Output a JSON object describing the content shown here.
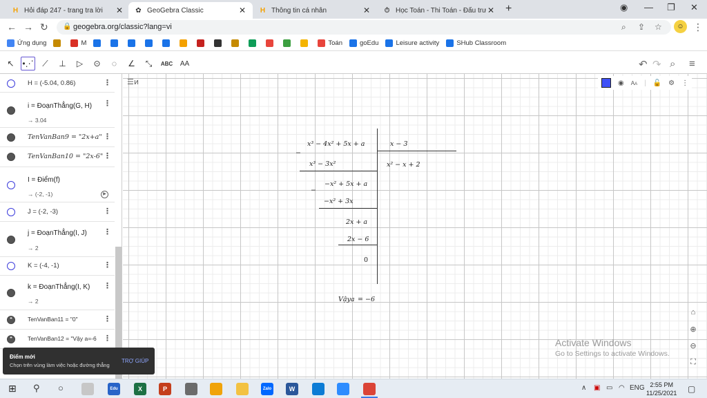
{
  "browser": {
    "tabs": [
      {
        "title": "Hỏi đáp 247 - trang tra lời",
        "favicon": "H"
      },
      {
        "title": "GeoGebra Classic",
        "favicon": "✿"
      },
      {
        "title": "Thông tin cá nhân",
        "favicon": "H"
      },
      {
        "title": "Học Toán - Thi Toán - Đấu trường",
        "favicon": "⏱"
      }
    ],
    "new_tab": "+",
    "url": "geogebra.org/classic?lang=vi",
    "bookmarks": [
      {
        "label": "Ứng dụng",
        "color": "#4285f4"
      },
      {
        "label": "",
        "color": "#c58a00"
      },
      {
        "label": "M",
        "color": "#d93025"
      },
      {
        "label": "",
        "color": "#1a73e8"
      },
      {
        "label": "",
        "color": "#1a73e8"
      },
      {
        "label": "",
        "color": "#1a73e8"
      },
      {
        "label": "",
        "color": "#1a73e8"
      },
      {
        "label": "",
        "color": "#1a73e8"
      },
      {
        "label": "",
        "color": "#f4a100"
      },
      {
        "label": "",
        "color": "#c5221f"
      },
      {
        "label": "",
        "color": "#333333"
      },
      {
        "label": "",
        "color": "#c58a00"
      },
      {
        "label": "",
        "color": "#0f9d58"
      },
      {
        "label": "",
        "color": "#e8453c"
      },
      {
        "label": "",
        "color": "#3c9f40"
      },
      {
        "label": "",
        "color": "#f4b400"
      },
      {
        "label": "Toán",
        "color": "#e8453c"
      },
      {
        "label": "goEdu",
        "color": "#1a73e8"
      },
      {
        "label": "Leisure activity",
        "color": "#1a73e8"
      },
      {
        "label": "SHub Classroom",
        "color": "#1a73e8"
      }
    ]
  },
  "toolbar": {
    "text_tool": "ABC",
    "font_tool": "AA"
  },
  "algebra": [
    {
      "def": "H = (-5.04, 0.86)",
      "val": "",
      "marker": "hollow"
    },
    {
      "def": "i = ĐoạnThẳng(G, H)",
      "val": "→ 3.04",
      "marker": "filled"
    },
    {
      "def": "TenVanBan9 = \"2x+a\"",
      "val": "",
      "marker": "filled"
    },
    {
      "def": "TenVanBan10 = \"2x-6\"",
      "val": "",
      "marker": "filled"
    },
    {
      "def": "I = Điểm(f)",
      "val": "→ (-2, -1)",
      "marker": "hollow"
    },
    {
      "def": "J = (-2, -3)",
      "val": "",
      "marker": "hollow"
    },
    {
      "def": "j = ĐoạnThẳng(I, J)",
      "val": "→ 2",
      "marker": "filled"
    },
    {
      "def": "K = (-4, -1)",
      "val": "",
      "marker": "hollow"
    },
    {
      "def": "k = ĐoạnThẳng(I, K)",
      "val": "→ 2",
      "marker": "filled"
    },
    {
      "def": "TenVanBan11 = \"0\"",
      "val": "",
      "marker": "quote"
    },
    {
      "def": "TenVanBan12 = \"Vậy a=-6",
      "val": "",
      "marker": "quote"
    }
  ],
  "division": {
    "dividend": "x³ − 4x² + 5x + a",
    "divisor": "x − 3",
    "quotient": "x² − x + 2",
    "minus1": "−",
    "sub1": "x³ − 3x²",
    "rem1": "−x² + 5x + a",
    "minus2": "−",
    "sub2": "−x² + 3x",
    "rem2": "2x + a",
    "sub3": "2x − 6",
    "rem3": "0",
    "conclusion_word": "Vậya",
    "conclusion_eq": "= −6"
  },
  "watermark": {
    "line1": "Activate Windows",
    "line2": "Go to Settings to activate Windows."
  },
  "toast": {
    "title": "Điểm mới",
    "message": "Chọn trên vùng làm việc hoặc đường thẳng",
    "help": "TRỢ GIÚP"
  },
  "taskbar": {
    "apps": [
      {
        "label": "",
        "color": "#c7c7c7"
      },
      {
        "label": "Edu",
        "color": "#2864c8"
      },
      {
        "label": "X",
        "color": "#1d7044"
      },
      {
        "label": "P",
        "color": "#c43e1c"
      },
      {
        "label": "",
        "color": "#6b6b6b"
      },
      {
        "label": "",
        "color": "#f0a30a"
      },
      {
        "label": "",
        "color": "#f3c242"
      },
      {
        "label": "Zalo",
        "color": "#0068ff"
      },
      {
        "label": "W",
        "color": "#2b579a"
      },
      {
        "label": "",
        "color": "#0c7cd5"
      },
      {
        "label": "",
        "color": "#2d8cff"
      },
      {
        "label": "",
        "color": "#db4437"
      }
    ],
    "lang": "ENG",
    "time": "2:55 PM",
    "date": "11/25/2021"
  }
}
